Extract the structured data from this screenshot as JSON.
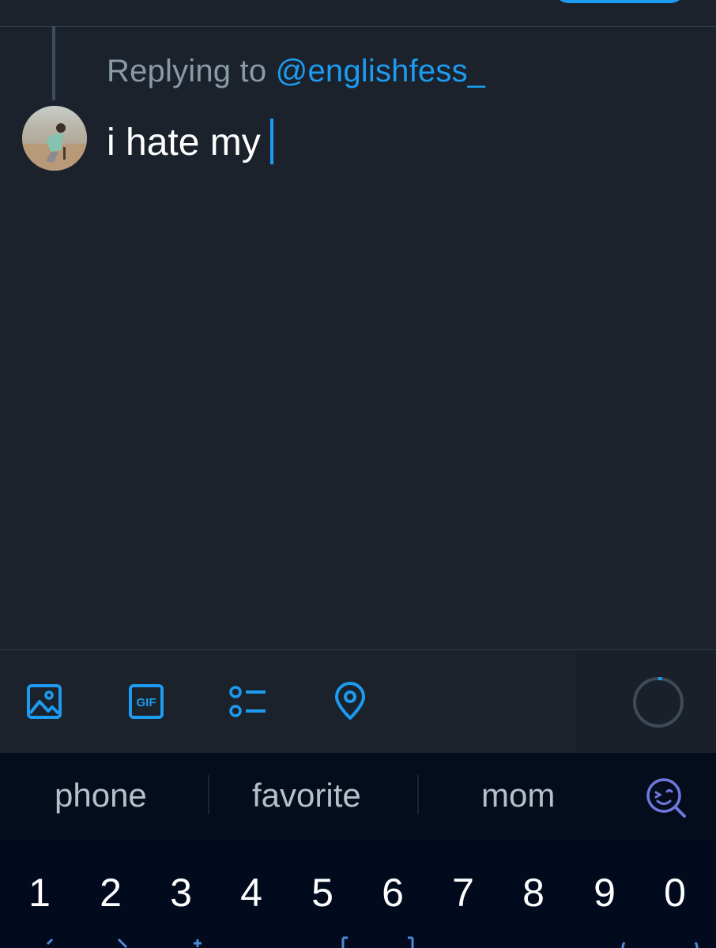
{
  "reply": {
    "replying_prefix": "Replying to",
    "handle": "@englishfess_"
  },
  "compose": {
    "text": "i hate my"
  },
  "toolbar": {
    "icons": [
      "image-icon",
      "gif-icon",
      "poll-icon",
      "location-icon"
    ],
    "gif_label": "GIF",
    "accent": "#1d9bf0"
  },
  "keyboard": {
    "suggestions": [
      "phone",
      "favorite",
      "mom"
    ],
    "number_row": [
      "1",
      "2",
      "3",
      "4",
      "5",
      "6",
      "7",
      "8",
      "9",
      "0"
    ]
  }
}
